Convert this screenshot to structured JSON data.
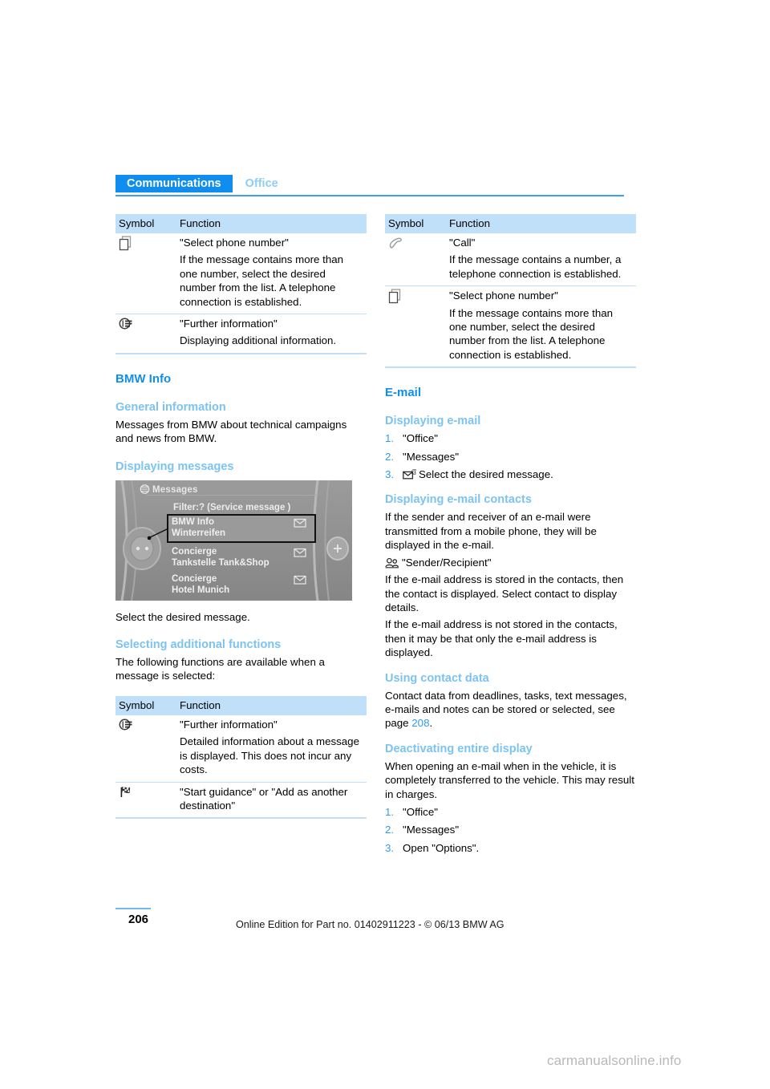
{
  "header": {
    "active_tab": "Communications",
    "inactive_tab": "Office"
  },
  "columns": {
    "left": {
      "table_top": {
        "col_symbol": "Symbol",
        "col_function": "Function",
        "rows": [
          {
            "icon": "copy-pages-icon",
            "title": "\"Select phone number\"",
            "body": "If the message contains more than one number, select the desired number from the list. A telephone connection is established."
          },
          {
            "icon": "further-information-icon",
            "title": "\"Further information\"",
            "body": "Displaying additional information."
          }
        ]
      },
      "bmw_info": {
        "heading": "BMW Info",
        "general": {
          "heading": "General information",
          "body": "Messages from BMW about technical campaigns and news from BMW."
        },
        "displaying": {
          "heading": "Displaying messages",
          "caption": "Select the desired message.",
          "screenshot": {
            "title": "Messages",
            "filter": "Filter:? (Service message )",
            "items": [
              {
                "line1": "BMW Info",
                "line2": "Winterreifen",
                "selected": true
              },
              {
                "line1": "Concierge",
                "line2": "Tankstelle Tank&Shop",
                "selected": false
              },
              {
                "line1": "Concierge",
                "line2": "Hotel Munich",
                "selected": false
              }
            ]
          }
        },
        "selecting": {
          "heading": "Selecting additional functions",
          "body": "The following functions are available when a message is selected:"
        }
      },
      "table_bottom": {
        "col_symbol": "Symbol",
        "col_function": "Function",
        "rows": [
          {
            "icon": "further-information-icon",
            "title": "\"Further information\"",
            "body": "Detailed information about a message is displayed. This does not incur any costs."
          },
          {
            "icon": "checkered-flag-icon",
            "title": "\"Start guidance\" or \"Add as another destination\"",
            "body": ""
          }
        ]
      }
    },
    "right": {
      "table_top": {
        "col_symbol": "Symbol",
        "col_function": "Function",
        "rows": [
          {
            "icon": "phone-handset-icon",
            "title": "\"Call\"",
            "body": "If the message contains a number, a telephone connection is established."
          },
          {
            "icon": "copy-pages-icon",
            "title": "\"Select phone number\"",
            "body": "If the message contains more than one number, select the desired number from the list. A telephone connection is established."
          }
        ]
      },
      "email": {
        "heading": "E-mail",
        "displaying": {
          "heading": "Displaying e-mail",
          "steps": [
            {
              "num": "1.",
              "text": "\"Office\"",
              "icon": ""
            },
            {
              "num": "2.",
              "text": "\"Messages\"",
              "icon": ""
            },
            {
              "num": "3.",
              "text": "Select the desired message.",
              "icon": "email-at-icon"
            }
          ]
        },
        "contacts": {
          "heading": "Displaying e-mail contacts",
          "para1": "If the sender and receiver of an e-mail were transmitted from a mobile phone, they will be displayed in the e-mail.",
          "icon_line": "\"Sender/Recipient\"",
          "icon_line_icon": "contacts-icon",
          "para2": "If the e-mail address is stored in the contacts, then the contact is displayed. Select contact to display details.",
          "para3": "If the e-mail address is not stored in the contacts, then it may be that only the e-mail address is displayed."
        },
        "contact_data": {
          "heading": "Using contact data",
          "body_before": "Contact data from deadlines, tasks, text messages, e-mails and notes can be stored or selected, see page ",
          "xref": "208",
          "body_after": "."
        },
        "deactivating": {
          "heading": "Deactivating entire display",
          "body": "When opening an e-mail when in the vehicle, it is completely transferred to the vehicle. This may result in charges.",
          "steps": [
            {
              "num": "1.",
              "text": "\"Office\""
            },
            {
              "num": "2.",
              "text": "\"Messages\""
            },
            {
              "num": "3.",
              "text": "Open \"Options\"."
            }
          ]
        }
      }
    }
  },
  "footer": {
    "page_number": "206",
    "copyright": "Online Edition for Part no. 01402911223 - © 06/13 BMW AG",
    "watermark": "carmanualsonline.info"
  },
  "colors": {
    "accent_blue": "#0f8ef0",
    "light_blue": "#7cc3f2",
    "table_header": "#bfe0f8",
    "xref_blue": "#2f9cf0"
  }
}
